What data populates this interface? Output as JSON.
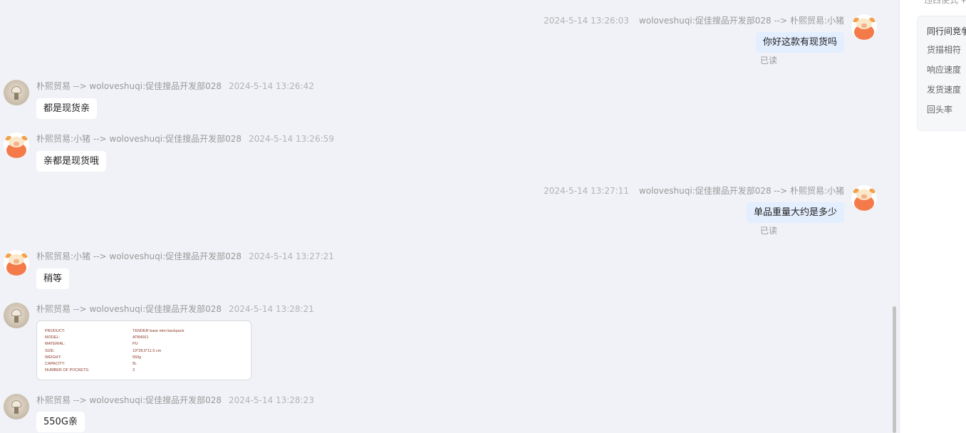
{
  "panel": {
    "top_text": "违西使式 ¥",
    "card_title": "同行间竞争",
    "metrics": [
      "货描相符",
      "响应速度",
      "发货速度",
      "回头率"
    ]
  },
  "messages": [
    {
      "side": "right",
      "time": "2024-5-14 13:26:03",
      "route": "woloveshuqi:促佳搜品开发部028 --> 朴熙贸易:小猪",
      "text": "你好这款有现货吗",
      "status": "已读",
      "avatar": "pig-avatar"
    },
    {
      "side": "left",
      "route": "朴熙贸易 --> woloveshuqi:促佳搜品开发部028",
      "time": "2024-5-14 13:26:42",
      "text": "都是现货亲",
      "avatar": "shop-avatar"
    },
    {
      "side": "left",
      "route": "朴熙贸易:小猪 --> woloveshuqi:促佳搜品开发部028",
      "time": "2024-5-14 13:26:59",
      "text": "亲都是现货哦",
      "avatar": "pig-avatar"
    },
    {
      "side": "right",
      "time": "2024-5-14 13:27:11",
      "route": "woloveshuqi:促佳搜品开发部028 --> 朴熙贸易:小猪",
      "text": "单品重量大约是多少",
      "status": "已读",
      "avatar": "pig-avatar"
    },
    {
      "side": "left",
      "route": "朴熙贸易:小猪 --> woloveshuqi:促佳搜品开发部028",
      "time": "2024-5-14 13:27:21",
      "text": "稍等",
      "avatar": "pig-avatar"
    },
    {
      "side": "left",
      "route": "朴熙贸易 --> woloveshuqi:促佳搜品开发部028",
      "time": "2024-5-14 13:28:21",
      "type": "image",
      "avatar": "shop-avatar"
    },
    {
      "side": "left",
      "route": "朴熙贸易 --> woloveshuqi:促佳搜品开发部028",
      "time": "2024-5-14 13:28:23",
      "text": "550G亲",
      "avatar": "shop-avatar"
    }
  ],
  "spec_image": {
    "rows": [
      {
        "key": "PRODUCT:",
        "value": "TENDER base mini backpack"
      },
      {
        "key": "MODEL:",
        "value": "ATB4001"
      },
      {
        "key": "MATERIAL:",
        "value": "PU"
      },
      {
        "key": "SIZE:",
        "value": "19*28.5*11.5 cm"
      },
      {
        "key": "WEIGHT:",
        "value": "550g"
      },
      {
        "key": "CAPACITY:",
        "value": "5L"
      },
      {
        "key": "NUMBER OF POCKETS:",
        "value": "3"
      }
    ]
  }
}
